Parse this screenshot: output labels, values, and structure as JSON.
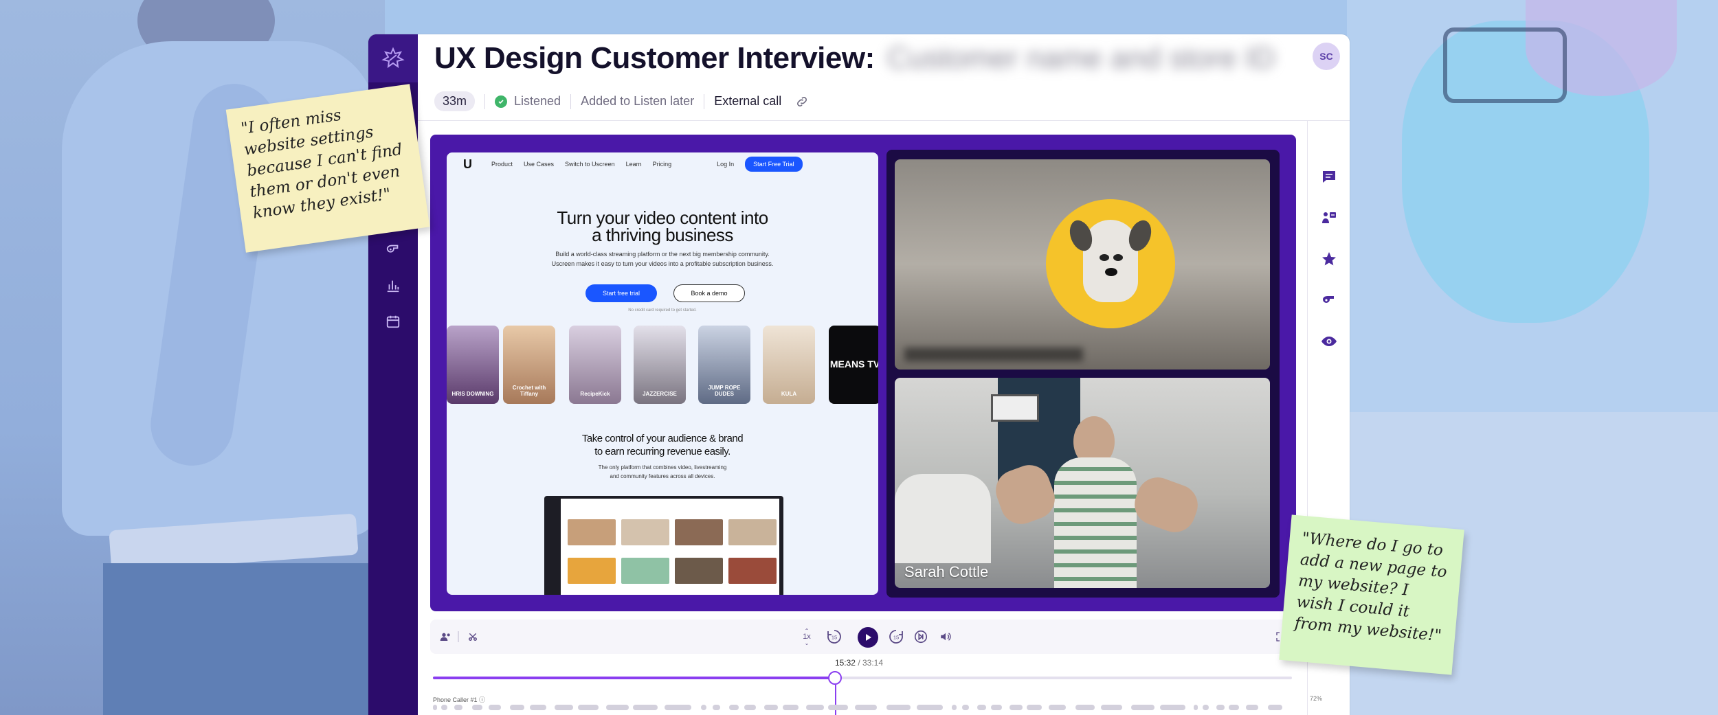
{
  "app": {
    "title": "UX Design Customer Interview:",
    "title_redacted": "Customer name and store ID",
    "avatar_initials": "SC",
    "brand_color": "#2c0c6b",
    "accent_color": "#8a3ef0"
  },
  "meta": {
    "duration": "33m",
    "listened_label": "Listened",
    "listen_later_label": "Added to Listen later",
    "call_type": "External call"
  },
  "left_nav": {
    "icons": [
      "logo-icon",
      "whistle-icon",
      "chart-icon",
      "calendar-icon"
    ]
  },
  "right_nav": {
    "icons": [
      "comments-icon",
      "team-icon",
      "star-icon",
      "whistle-icon",
      "eye-icon"
    ]
  },
  "shared_screen": {
    "nav": {
      "items": [
        "Product",
        "Use Cases",
        "Switch to Uscreen",
        "Learn",
        "Pricing"
      ],
      "login": "Log In",
      "trial": "Start Free Trial"
    },
    "hero_line1": "Turn your video content into",
    "hero_line2": "a thriving business",
    "sub_line1": "Build a world-class streaming platform or the next big membership community.",
    "sub_line2": "Uscreen makes it easy to turn your videos into a profitable subscription business.",
    "cta_primary": "Start free trial",
    "cta_secondary": "Book a demo",
    "cta_note": "No credit card required to get started.",
    "thumbnails": [
      "HRIS DOWNING",
      "Crochet with Tiffany",
      "RecipeKick",
      "JAZZERCISE",
      "JUMP ROPE DUDES",
      "KULA",
      "MEANS TV"
    ],
    "section_line1": "Take control of your audience & brand",
    "section_line2": "to earn recurring revenue easily.",
    "section_sub1": "The only platform that combines video, livestreaming",
    "section_sub2": "and community features across all devices."
  },
  "participants": [
    {
      "name": ""
    },
    {
      "name": "Sarah Cottle"
    }
  ],
  "player": {
    "speed": "1x",
    "skip_back": "15",
    "skip_forward": "15",
    "current_time": "15:32",
    "total_time": "33:14",
    "progress": 0.468,
    "track_label": "Phone Caller #1",
    "track_percent": "72%"
  },
  "notes": {
    "note1": "\"I often miss website settings because I can't find them or don't even know they exist!\"",
    "note2": "\"Where do I go to add a new page to my website? I wish I could it from my website!\""
  }
}
